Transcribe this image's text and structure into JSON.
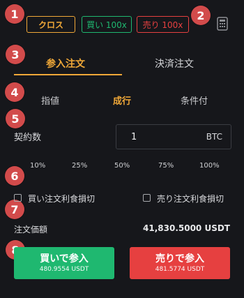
{
  "badges": [
    "1",
    "2",
    "3",
    "4",
    "5",
    "6",
    "7",
    "8"
  ],
  "margin_mode": {
    "cross_label": "クロス",
    "buy_leverage": "買い 100x",
    "sell_leverage": "売り 100x"
  },
  "tabs": {
    "open_label": "参入注文",
    "close_label": "決済注文"
  },
  "order_types": {
    "limit": "指値",
    "market": "成行",
    "conditional": "条件付"
  },
  "contracts": {
    "label": "契約数",
    "value": "1",
    "unit": "BTC"
  },
  "percent_options": [
    "10%",
    "25%",
    "50%",
    "75%",
    "100%"
  ],
  "tp_sl": {
    "buy_label": "買い注文利食損切",
    "sell_label": "売り注文利食損切"
  },
  "order_value": {
    "label": "注文価額",
    "value": "41,830.5000 USDT"
  },
  "actions": {
    "buy_label": "買いで参入",
    "buy_cost": "480.9554 USDT",
    "sell_label": "売りで参入",
    "sell_cost": "481.5774 USDT"
  },
  "icons": {
    "calculator": "calculator-icon",
    "checkbox": "checkbox-icon"
  },
  "colors": {
    "accent": "#f0a838",
    "buy": "#1fb870",
    "sell": "#e64040",
    "badge": "#d24b4b",
    "background": "#16171b"
  }
}
